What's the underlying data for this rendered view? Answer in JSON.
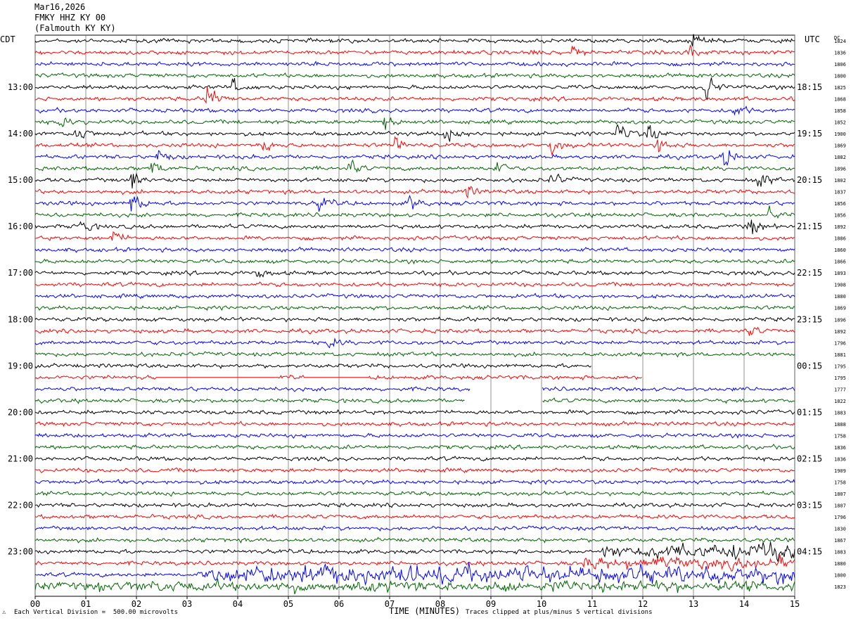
{
  "header": {
    "date": "Mar16,2026",
    "station": "FMKY HHZ KY 00",
    "location": "(Falmouth KY KY)"
  },
  "left_timezone": "CDT",
  "right_timezone": "UTC",
  "dc_label": "DC",
  "footer": {
    "scale": "Each Vertical Division =  500.00 microvolts",
    "clip": "Traces clipped at plus/minus 5 vertical divisions",
    "corner": "⚠"
  },
  "colors": {
    "black": "#000000",
    "red": "#ff0000",
    "blue": "#0000ff",
    "green": "#006400"
  },
  "chart_data": {
    "type": "line",
    "title": "FMKY HHZ KY 00",
    "xlabel": "TIME (MINUTES)",
    "x_ticks": [
      "00",
      "01",
      "02",
      "03",
      "04",
      "05",
      "06",
      "07",
      "08",
      "09",
      "10",
      "11",
      "12",
      "13",
      "14",
      "15"
    ],
    "xlim": [
      0,
      15
    ],
    "grid": true,
    "trace_colors_cycle": [
      "black",
      "red",
      "blue",
      "green"
    ],
    "left_hour_labels": [
      "13:00",
      "14:00",
      "15:00",
      "16:00",
      "17:00",
      "18:00",
      "19:00",
      "20:00",
      "21:00",
      "22:00",
      "23:00"
    ],
    "right_hour_labels": [
      "18:15",
      "19:15",
      "20:15",
      "21:15",
      "22:15",
      "23:15",
      "00:15",
      "01:15",
      "02:15",
      "03:15",
      "04:15"
    ],
    "dc_offsets": [
      1824,
      1836,
      1806,
      1800,
      1825,
      1868,
      1858,
      1852,
      1900,
      1869,
      1882,
      1896,
      1802,
      1837,
      1856,
      1856,
      1892,
      1886,
      1860,
      1866,
      1893,
      1908,
      1880,
      1869,
      1896,
      1892,
      1796,
      1881,
      1795,
      1795,
      1777,
      1822,
      1883,
      1888,
      1758,
      1836,
      1836,
      1909,
      1758,
      1807,
      1807,
      1796,
      1830,
      1867,
      1883,
      1880,
      1800,
      1823
    ],
    "events": [
      {
        "trace": 0,
        "minute": 13.0,
        "amp": 1.3
      },
      {
        "trace": 1,
        "minute": 9.8,
        "amp": 0.9
      },
      {
        "trace": 1,
        "minute": 10.6,
        "amp": 0.8
      },
      {
        "trace": 1,
        "minute": 12.9,
        "amp": 0.9
      },
      {
        "trace": 4,
        "minute": 13.2,
        "amp": 2.6
      },
      {
        "trace": 4,
        "minute": 3.9,
        "amp": 1.2
      },
      {
        "trace": 5,
        "minute": 3.4,
        "amp": 2.6
      },
      {
        "trace": 6,
        "minute": 13.8,
        "amp": 1.1
      },
      {
        "trace": 7,
        "minute": 6.9,
        "amp": 1.4
      },
      {
        "trace": 7,
        "minute": 0.5,
        "amp": 0.9
      },
      {
        "trace": 8,
        "minute": 0.8,
        "amp": 1.6
      },
      {
        "trace": 8,
        "minute": 8.1,
        "amp": 1.8
      },
      {
        "trace": 8,
        "minute": 11.5,
        "amp": 2.0
      },
      {
        "trace": 8,
        "minute": 12.1,
        "amp": 1.6
      },
      {
        "trace": 9,
        "minute": 4.5,
        "amp": 1.2
      },
      {
        "trace": 9,
        "minute": 7.1,
        "amp": 1.5
      },
      {
        "trace": 9,
        "minute": 10.2,
        "amp": 1.3
      },
      {
        "trace": 9,
        "minute": 12.3,
        "amp": 1.8
      },
      {
        "trace": 10,
        "minute": 13.6,
        "amp": 2.0
      },
      {
        "trace": 10,
        "minute": 2.4,
        "amp": 1.1
      },
      {
        "trace": 11,
        "minute": 2.3,
        "amp": 1.3
      },
      {
        "trace": 11,
        "minute": 6.2,
        "amp": 1.3
      },
      {
        "trace": 11,
        "minute": 9.1,
        "amp": 1.5
      },
      {
        "trace": 12,
        "minute": 1.9,
        "amp": 1.9
      },
      {
        "trace": 12,
        "minute": 10.2,
        "amp": 1.2
      },
      {
        "trace": 12,
        "minute": 14.3,
        "amp": 1.4
      },
      {
        "trace": 13,
        "minute": 8.5,
        "amp": 1.0
      },
      {
        "trace": 14,
        "minute": 1.9,
        "amp": 2.1
      },
      {
        "trace": 14,
        "minute": 5.6,
        "amp": 1.2
      },
      {
        "trace": 14,
        "minute": 7.4,
        "amp": 1.2
      },
      {
        "trace": 15,
        "minute": 14.5,
        "amp": 1.2
      },
      {
        "trace": 16,
        "minute": 0.9,
        "amp": 1.2
      },
      {
        "trace": 16,
        "minute": 14.1,
        "amp": 2.0
      },
      {
        "trace": 17,
        "minute": 1.5,
        "amp": 1.4
      },
      {
        "trace": 20,
        "minute": 4.4,
        "amp": 0.8
      },
      {
        "trace": 26,
        "minute": 5.8,
        "amp": 0.9
      },
      {
        "trace": 25,
        "minute": 14.1,
        "amp": 0.8
      }
    ],
    "gaps": [
      {
        "trace": 28,
        "from": 11.0,
        "to": 15.0
      },
      {
        "trace": 29,
        "from": 12.0,
        "to": 15.0
      },
      {
        "trace": 30,
        "from": 8.6,
        "to": 10.0
      },
      {
        "trace": 31,
        "from": 8.5,
        "to": 10.0
      }
    ],
    "flat_segments": [
      {
        "trace": 29,
        "from": 2.4,
        "to": 4.8
      },
      {
        "trace": 29,
        "from": 5.3,
        "to": 6.6
      }
    ],
    "noisy_traces": [
      {
        "trace": 44,
        "from": 11.2,
        "to": 15.0,
        "amp": 2.2
      },
      {
        "trace": 45,
        "from": 10.8,
        "to": 15.0,
        "amp": 1.6
      },
      {
        "trace": 46,
        "from": 3.2,
        "to": 15.0,
        "amp": 2.6
      },
      {
        "trace": 47,
        "from": 0.0,
        "to": 15.0,
        "amp": 1.2
      }
    ]
  }
}
